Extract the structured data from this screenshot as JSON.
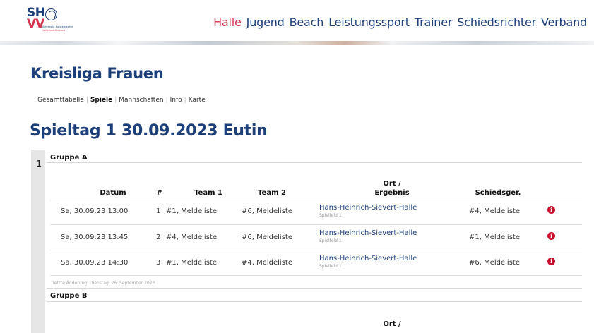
{
  "logo": {
    "abbr_top": "SH",
    "abbr_bottom": "VV",
    "tagline_1": "Schleswig-Holsteinischer",
    "tagline_2": "Volleyball-Verband"
  },
  "nav": {
    "items": [
      {
        "label": "Halle",
        "active": true
      },
      {
        "label": "Jugend",
        "active": false
      },
      {
        "label": "Beach",
        "active": false
      },
      {
        "label": "Leistungssport",
        "active": false
      },
      {
        "label": "Trainer",
        "active": false
      },
      {
        "label": "Schiedsrichter",
        "active": false
      },
      {
        "label": "Verband",
        "active": false
      }
    ]
  },
  "page": {
    "title": "Kreisliga Frauen",
    "subnav": [
      {
        "label": "Gesamttabelle",
        "active": false
      },
      {
        "label": "Spiele",
        "active": true
      },
      {
        "label": "Mannschaften",
        "active": false
      },
      {
        "label": "Info",
        "active": false
      },
      {
        "label": "Karte",
        "active": false
      }
    ],
    "spieltag_title": "Spieltag 1 30.09.2023 Eutin",
    "day_number": "1"
  },
  "groups": [
    {
      "label": "Gruppe A"
    },
    {
      "label": "Gruppe B"
    }
  ],
  "table": {
    "headers": {
      "datum": "Datum",
      "nr": "#",
      "team1": "Team 1",
      "team2": "Team 2",
      "ort_line1": "Ort /",
      "ort_line2": "Ergebnis",
      "schiedsger": "Schiedsger."
    },
    "rows": [
      {
        "datum": "Sa, 30.09.23 13:00",
        "nr": "1",
        "team1": "#1, Meldeliste",
        "team2": "#6, Meldeliste",
        "venue": "Hans-Heinrich-Sievert-Halle",
        "field": "Spielfeld 1",
        "schiedsger": "#4, Meldeliste"
      },
      {
        "datum": "Sa, 30.09.23 13:45",
        "nr": "2",
        "team1": "#4, Meldeliste",
        "team2": "#6, Meldeliste",
        "venue": "Hans-Heinrich-Sievert-Halle",
        "field": "Spielfeld 1",
        "schiedsger": "#1, Meldeliste"
      },
      {
        "datum": "Sa, 30.09.23 14:30",
        "nr": "3",
        "team1": "#1, Meldeliste",
        "team2": "#4, Meldeliste",
        "venue": "Hans-Heinrich-Sievert-Halle",
        "field": "Spielfeld 1",
        "schiedsger": "#6, Meldeliste"
      }
    ],
    "info_icon_glyph": "i"
  },
  "footnote": "letzte Änderung: Dienstag, 26. September 2023",
  "group_b_header": {
    "ort_line1": "Ort /"
  }
}
